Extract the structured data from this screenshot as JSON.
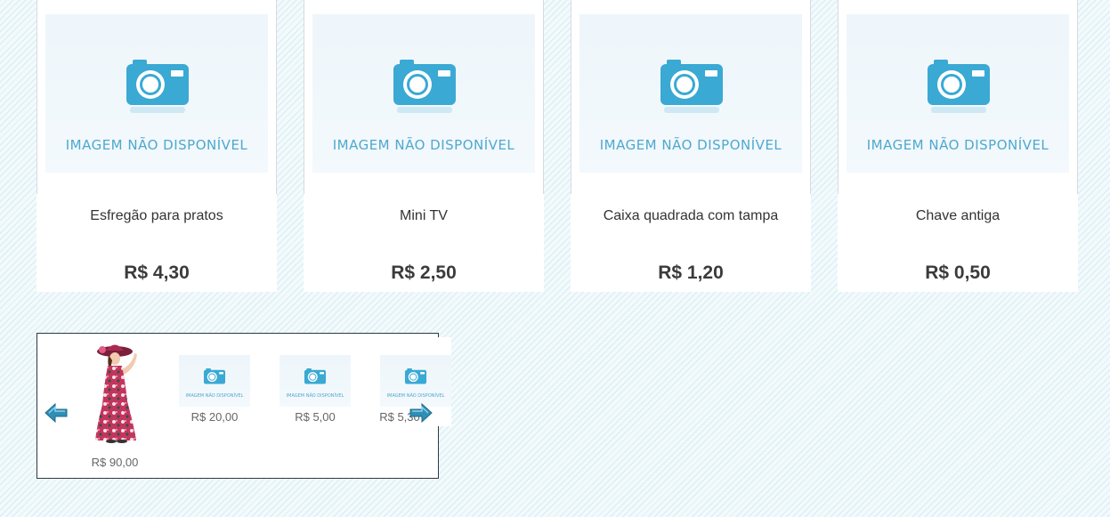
{
  "placeholder_text": "IMAGEM NÃO DISPONÍVEL",
  "products": [
    {
      "name": "Esfregão para pratos",
      "price": "R$ 4,30"
    },
    {
      "name": "Mini TV",
      "price": "R$ 2,50"
    },
    {
      "name": "Caixa quadrada com tampa",
      "price": "R$ 1,20"
    },
    {
      "name": "Chave antiga",
      "price": "R$ 0,50"
    }
  ],
  "carousel": {
    "prev_icon": "arrow-left-icon",
    "next_icon": "arrow-right-icon",
    "items": [
      {
        "price": "R$ 90,00",
        "image": "doll-photo"
      },
      {
        "price": "R$ 20,00",
        "image": "placeholder"
      },
      {
        "price": "R$ 5,00",
        "image": "placeholder"
      },
      {
        "price": "R$ 5,30",
        "image": "placeholder"
      }
    ]
  },
  "colors": {
    "camera": "#3aa9d4",
    "price_text": "#3b3b3b",
    "arrow": "#2f8fb6"
  }
}
